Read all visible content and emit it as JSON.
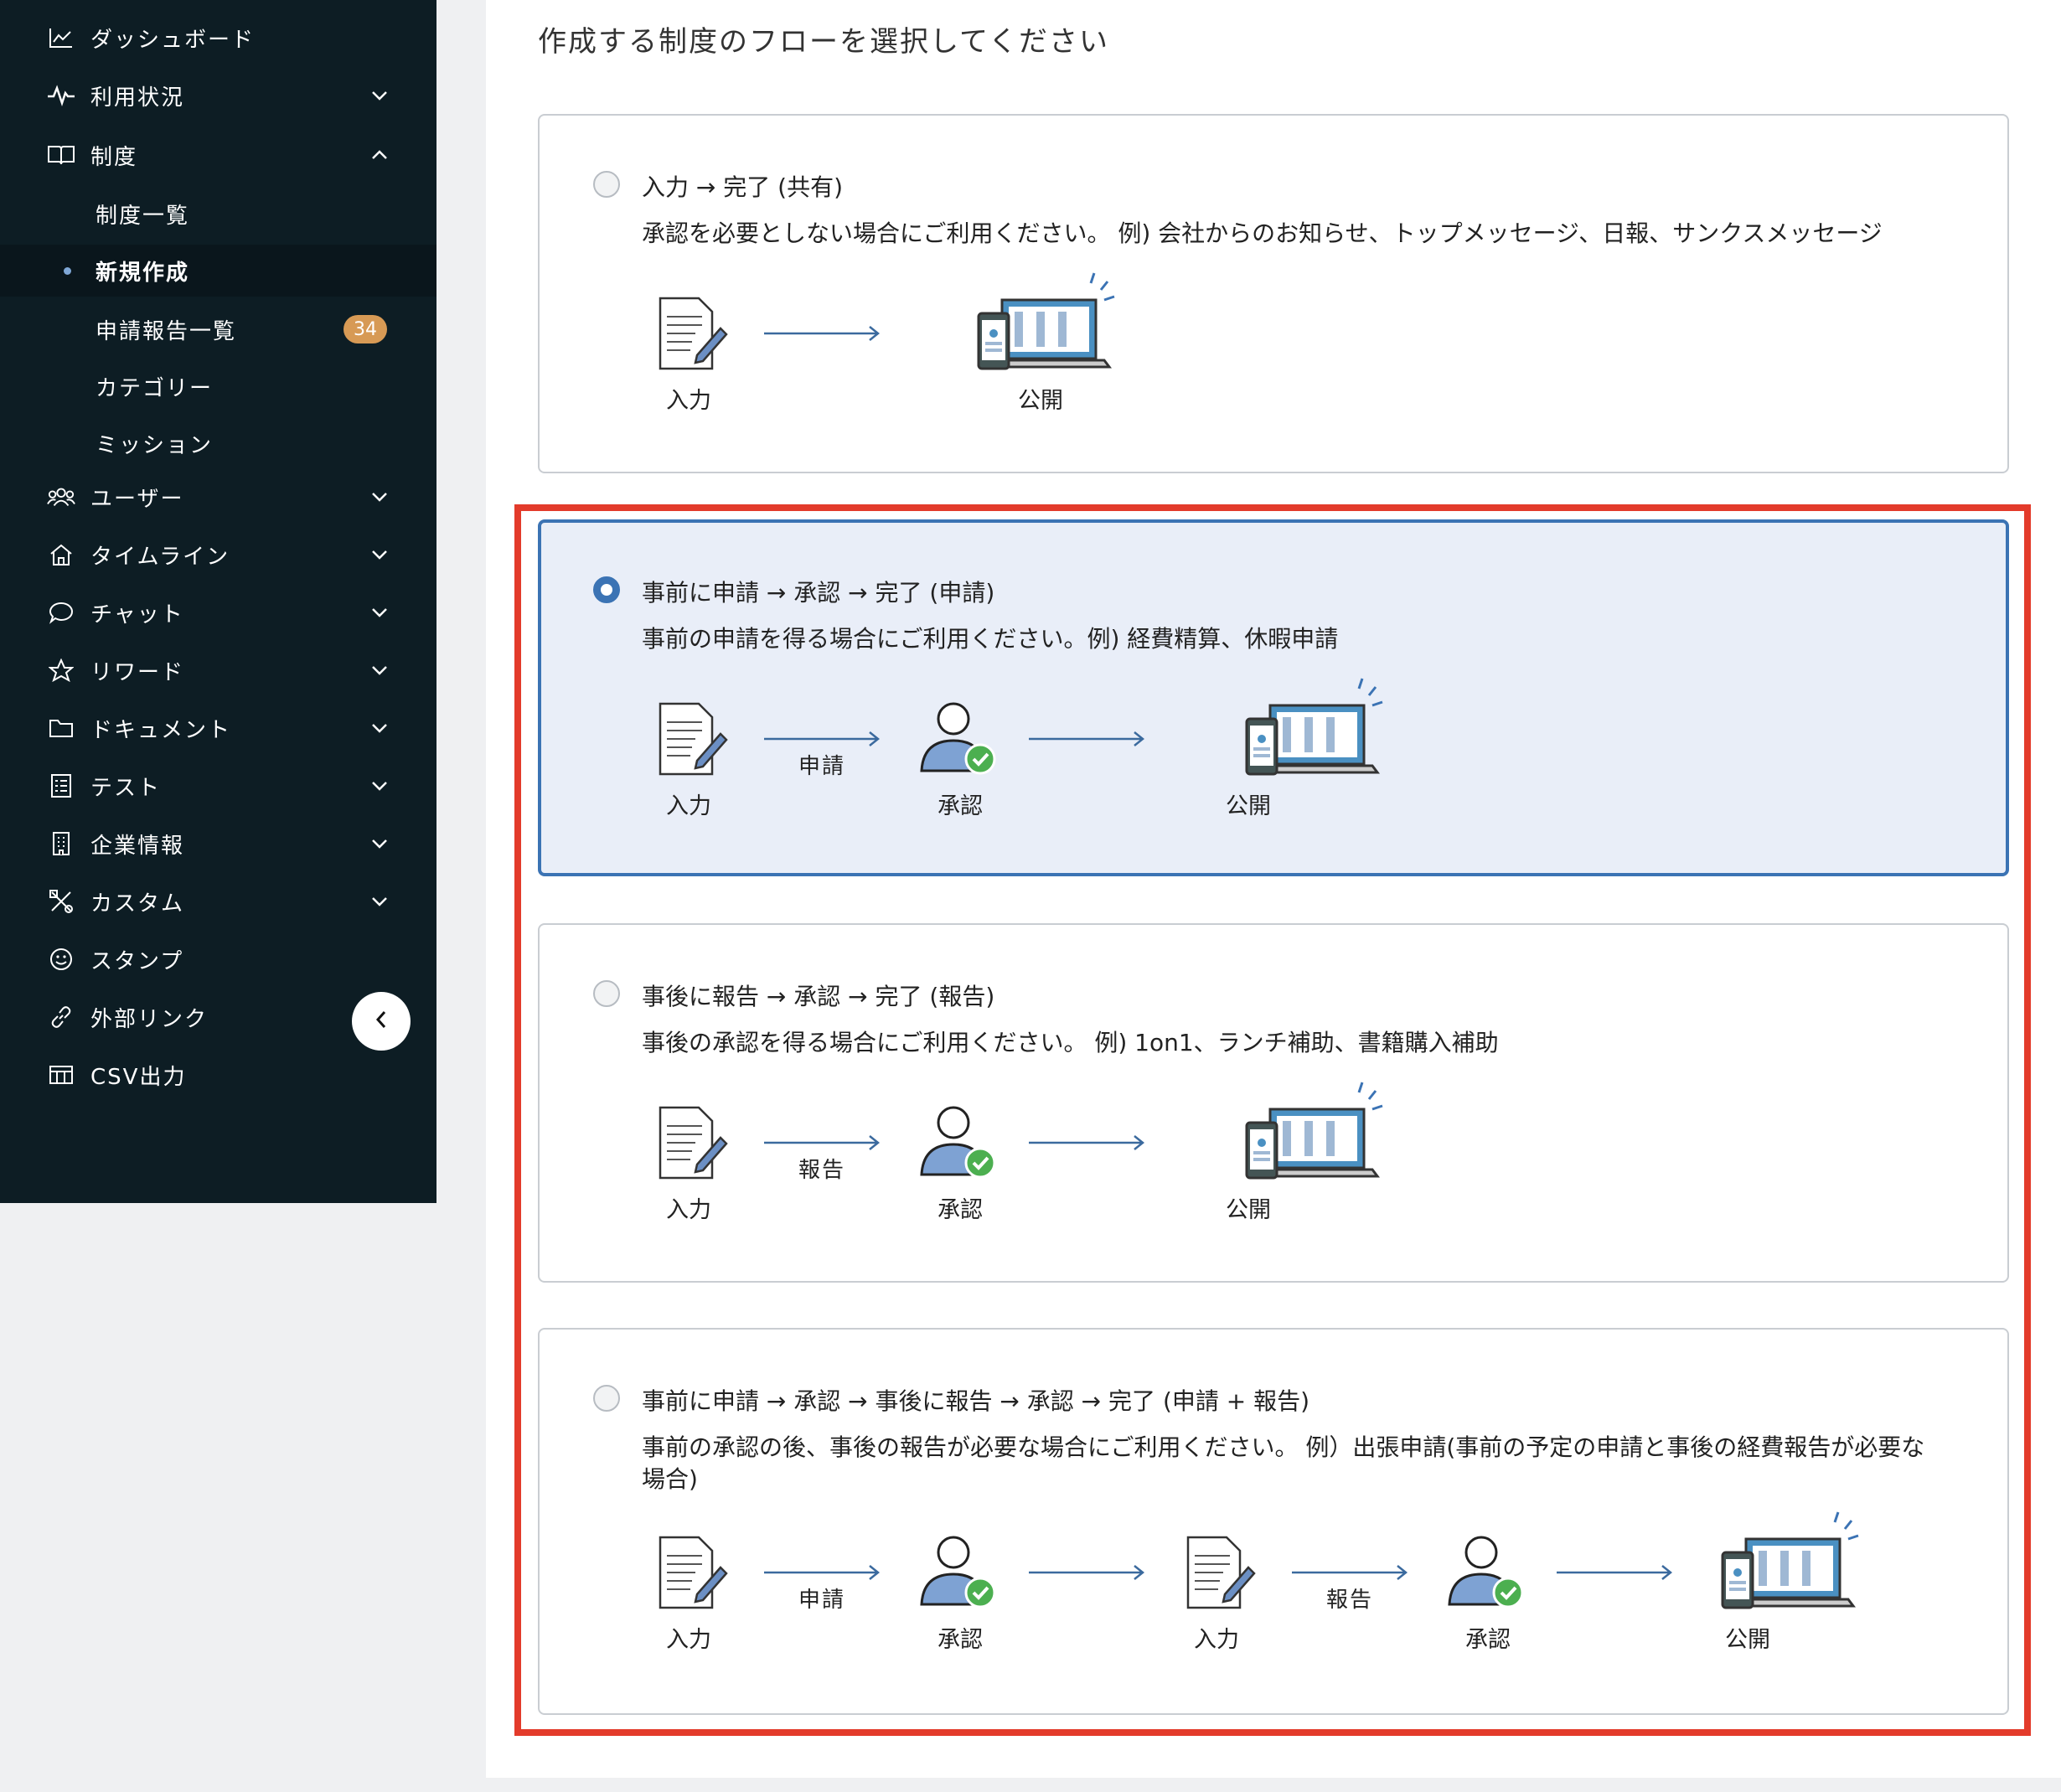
{
  "sidebar": {
    "items": [
      {
        "label": "ダッシュボード",
        "icon": "chart-icon",
        "chevron": ""
      },
      {
        "label": "利用状況",
        "icon": "pulse-icon",
        "chevron": "down"
      },
      {
        "label": "制度",
        "icon": "book-icon",
        "chevron": "up"
      },
      {
        "label": "ユーザー",
        "icon": "users-icon",
        "chevron": "down"
      },
      {
        "label": "タイムライン",
        "icon": "home-icon",
        "chevron": "down"
      },
      {
        "label": "チャット",
        "icon": "chat-icon",
        "chevron": "down"
      },
      {
        "label": "リワード",
        "icon": "star-icon",
        "chevron": "down"
      },
      {
        "label": "ドキュメント",
        "icon": "folder-icon",
        "chevron": "down"
      },
      {
        "label": "テスト",
        "icon": "checklist-icon",
        "chevron": "down"
      },
      {
        "label": "企業情報",
        "icon": "building-icon",
        "chevron": "down"
      },
      {
        "label": "カスタム",
        "icon": "tools-icon",
        "chevron": "down"
      },
      {
        "label": "スタンプ",
        "icon": "smile-icon",
        "chevron": ""
      },
      {
        "label": "外部リンク",
        "icon": "link-icon",
        "chevron": ""
      },
      {
        "label": "CSV出力",
        "icon": "table-icon",
        "chevron": ""
      }
    ],
    "sub_items": [
      {
        "label": "制度一覧"
      },
      {
        "label": "新規作成",
        "active": true
      },
      {
        "label": "申請報告一覧",
        "badge": "34"
      },
      {
        "label": "カテゴリー"
      },
      {
        "label": "ミッション"
      }
    ]
  },
  "main": {
    "title": "作成する制度のフローを選択してください",
    "options": [
      {
        "title": "入力 → 完了 (共有)",
        "description": "承認を必要としない場合にご利用ください。 例) 会社からのお知らせ、トップメッセージ、日報、サンクスメッセージ",
        "selected": false,
        "steps": [
          "入力",
          "公開"
        ],
        "arrows": [
          ""
        ]
      },
      {
        "title": "事前に申請 → 承認 → 完了 (申請)",
        "description": "事前の申請を得る場合にご利用ください。例) 経費精算、休暇申請",
        "selected": true,
        "steps": [
          "入力",
          "承認",
          "公開"
        ],
        "arrows": [
          "申請",
          ""
        ]
      },
      {
        "title": "事後に報告 → 承認 → 完了 (報告)",
        "description": "事後の承認を得る場合にご利用ください。 例) 1on1、ランチ補助、書籍購入補助",
        "selected": false,
        "steps": [
          "入力",
          "承認",
          "公開"
        ],
        "arrows": [
          "報告",
          ""
        ]
      },
      {
        "title": "事前に申請 → 承認 → 事後に報告 → 承認 → 完了 (申請 + 報告)",
        "description": "事前の承認の後、事後の報告が必要な場合にご利用ください。 例）出張申請(事前の予定の申請と事後の経費報告が必要な場合)",
        "selected": false,
        "steps": [
          "入力",
          "承認",
          "入力",
          "承認",
          "公開"
        ],
        "arrows": [
          "申請",
          "",
          "報告",
          ""
        ]
      }
    ]
  },
  "colors": {
    "sidebar_bg": "#0d1d24",
    "accent": "#3b73b4",
    "badge": "#d79a55",
    "highlight": "#e33b2b",
    "selected_bg": "#e9eef8"
  }
}
